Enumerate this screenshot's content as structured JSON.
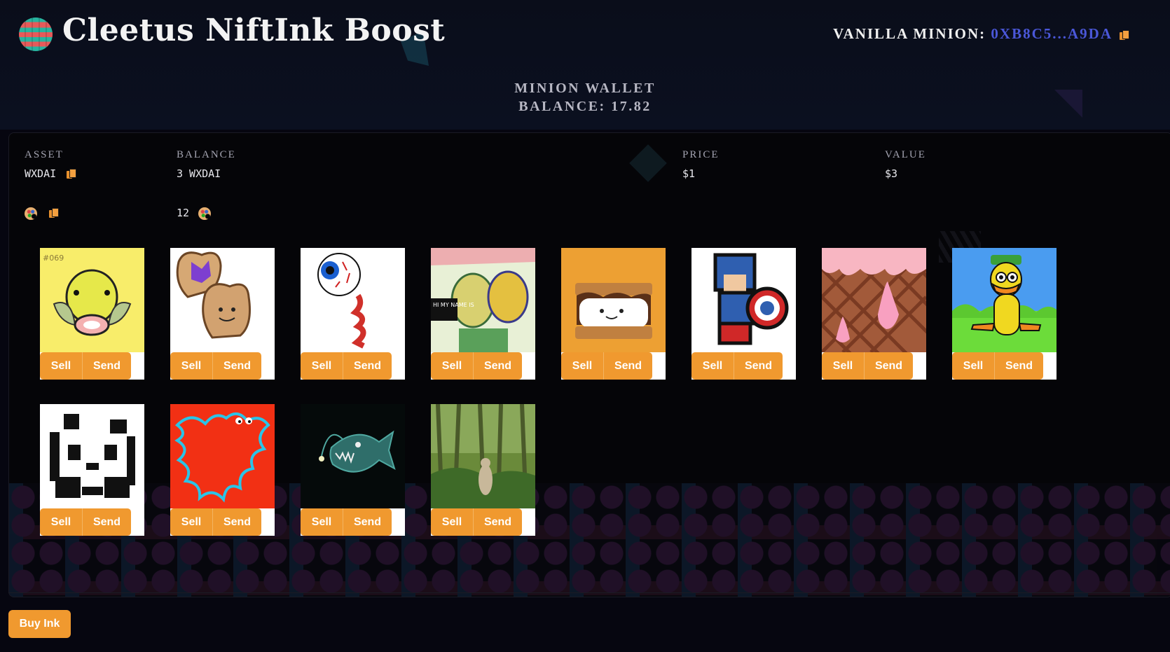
{
  "header": {
    "title": "Cleetus NiftInk Boost",
    "minion_label": "VANILLA MINION:",
    "minion_address": "0XB8C5...A9DA"
  },
  "wallet": {
    "title": "MINION WALLET",
    "balance": "BALANCE: 17.82"
  },
  "table": {
    "columns": [
      "ASSET",
      "BALANCE",
      "PRICE",
      "VALUE"
    ],
    "rows": [
      {
        "asset": "WXDAI",
        "balance": "3 WXDAI",
        "price": "$1",
        "value": "$3"
      },
      {
        "asset_icon": "palette-icon",
        "balance": "12"
      }
    ]
  },
  "nfts": [
    {
      "name": "yellow-bellsprout",
      "sell": "Sell",
      "send": "Send",
      "label": "#069"
    },
    {
      "name": "pb-and-jelly-toast",
      "sell": "Sell",
      "send": "Send"
    },
    {
      "name": "eyeball",
      "sell": "Sell",
      "send": "Send"
    },
    {
      "name": "graffiti-faces",
      "sell": "Sell",
      "send": "Send",
      "label": "HI MY NAME IS"
    },
    {
      "name": "smore",
      "sell": "Sell",
      "send": "Send"
    },
    {
      "name": "pixel-captain",
      "sell": "Sell",
      "send": "Send"
    },
    {
      "name": "ice-cream-cone",
      "sell": "Sell",
      "send": "Send"
    },
    {
      "name": "yellow-duck",
      "sell": "Sell",
      "send": "Send"
    },
    {
      "name": "pixel-panda",
      "sell": "Sell",
      "send": "Send"
    },
    {
      "name": "blue-squiggle-on-red",
      "sell": "Sell",
      "send": "Send"
    },
    {
      "name": "anglerfish",
      "sell": "Sell",
      "send": "Send"
    },
    {
      "name": "jungle-scene",
      "sell": "Sell",
      "send": "Send"
    }
  ],
  "footer": {
    "buy_label": "Buy Ink"
  },
  "colors": {
    "accent": "#f0992f",
    "address": "#4a57d8",
    "background": "#060610"
  }
}
